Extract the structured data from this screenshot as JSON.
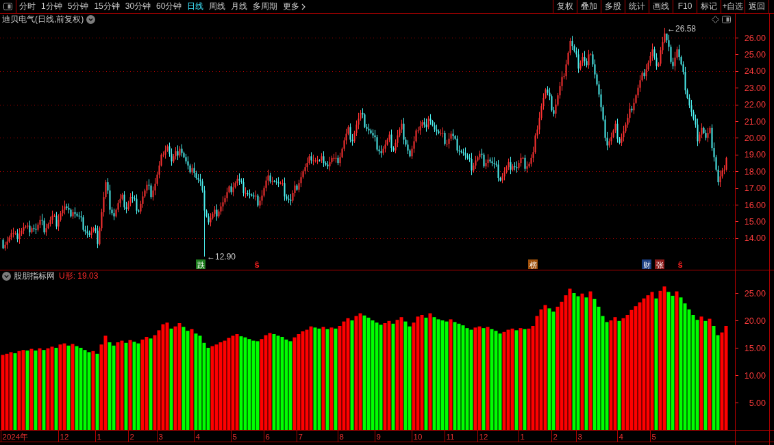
{
  "toolbar": {
    "periods": [
      {
        "label": "分时",
        "selected": false
      },
      {
        "label": "1分钟",
        "selected": false
      },
      {
        "label": "5分钟",
        "selected": false
      },
      {
        "label": "15分钟",
        "selected": false
      },
      {
        "label": "30分钟",
        "selected": false
      },
      {
        "label": "60分钟",
        "selected": false
      },
      {
        "label": "日线",
        "selected": true
      },
      {
        "label": "周线",
        "selected": false
      },
      {
        "label": "月线",
        "selected": false
      },
      {
        "label": "多周期",
        "selected": false
      }
    ],
    "more": "更多",
    "actions": [
      "复权",
      "叠加",
      "多股",
      "统计",
      "画线",
      "F10",
      "标记",
      "+自选",
      "返回"
    ]
  },
  "price_panel": {
    "title": "迪贝电气(日线,前复权)",
    "price_labels": [
      "←12.90",
      "←26.58"
    ],
    "events": [
      {
        "kind": "badge",
        "label": "跌",
        "color": "#1f7f1f"
      },
      {
        "kind": "mark",
        "label": "ŝ",
        "color": "#ff2020"
      },
      {
        "kind": "badge",
        "label": "榜",
        "color": "#a0500a"
      },
      {
        "kind": "badge",
        "label": "财",
        "color": "#1c3f82"
      },
      {
        "kind": "badge",
        "label": "张",
        "color": "#8c1a1a"
      },
      {
        "kind": "mark",
        "label": "ŝ",
        "color": "#ff2020"
      }
    ],
    "price_axis": [
      "26.00",
      "25.00",
      "24.00",
      "23.00",
      "22.00",
      "21.00",
      "20.00",
      "19.00",
      "18.00",
      "17.00",
      "16.00",
      "15.00",
      "14.00"
    ]
  },
  "indicator_panel": {
    "title": "股朋指标网",
    "reading": "U形: 19.03",
    "chart_data": {
      "type": "bar",
      "stacked": true,
      "ylim": [
        0,
        27
      ],
      "yticks": [
        {
          "value": 5,
          "label": "5.00"
        },
        {
          "value": 10,
          "label": "10.00"
        },
        {
          "value": 15,
          "label": "15.00"
        },
        {
          "value": 20,
          "label": "20.00"
        },
        {
          "value": 25,
          "label": "25.00"
        }
      ],
      "series": [
        {
          "color": "#ff0000",
          "values": [
            13.7,
            13.9,
            14.2,
            null,
            14.4,
            14.6,
            null,
            14.8,
            null,
            14.9,
            null,
            14.9,
            15.2,
            null,
            15.6,
            15.8,
            null,
            15.7,
            null,
            null,
            null,
            null,
            14.4,
            null,
            15.6,
            17.2,
            null,
            null,
            16.0,
            16.3,
            null,
            16.4,
            null,
            null,
            16.5,
            17.0,
            null,
            17.3,
            18.2,
            19.3,
            19.6,
            null,
            18.9,
            19.5,
            null,
            null,
            18.4,
            null,
            null,
            null,
            null,
            15.3,
            15.6,
            16.0,
            16.3,
            16.8,
            17.2,
            17.5,
            null,
            null,
            null,
            null,
            null,
            16.6,
            17.3,
            17.7,
            null,
            null,
            null,
            null,
            null,
            16.9,
            17.5,
            18.0,
            18.3,
            18.9,
            null,
            null,
            18.8,
            null,
            18.7,
            null,
            19.0,
            19.8,
            20.4,
            null,
            20.8,
            21.3,
            null,
            null,
            null,
            null,
            null,
            19.5,
            19.9,
            null,
            20.1,
            20.6,
            null,
            null,
            19.6,
            20.7,
            21.0,
            null,
            21.3,
            null,
            null,
            null,
            null,
            20.2,
            null,
            null,
            null,
            null,
            null,
            18.7,
            18.9,
            null,
            18.8,
            null,
            null,
            null,
            17.9,
            18.3,
            18.5,
            null,
            18.6,
            null,
            18.5,
            19.0,
            20.8,
            22.0,
            22.8,
            null,
            null,
            22.5,
            23.4,
            24.6,
            25.8,
            null,
            null,
            24.9,
            null,
            25.3,
            null,
            null,
            null,
            null,
            20.0,
            20.6,
            null,
            20.4,
            21.0,
            21.9,
            22.6,
            23.3,
            24.0,
            24.6,
            25.2,
            null,
            25.4,
            26.2,
            null,
            null,
            25.3,
            null,
            null,
            null,
            null,
            null,
            20.7,
            null,
            20.3,
            null,
            null,
            17.8,
            19.0
          ]
        },
        {
          "color": "#00ff00",
          "values": [
            null,
            null,
            null,
            14.0,
            null,
            null,
            14.5,
            null,
            14.5,
            null,
            14.6,
            null,
            null,
            15.0,
            null,
            null,
            15.4,
            null,
            15.3,
            15.0,
            14.6,
            14.2,
            null,
            13.9,
            null,
            null,
            16.0,
            15.4,
            null,
            null,
            15.9,
            null,
            16.1,
            15.8,
            null,
            null,
            16.7,
            null,
            null,
            null,
            null,
            18.5,
            null,
            null,
            18.8,
            18.1,
            null,
            17.6,
            17.2,
            15.9,
            15.0,
            null,
            null,
            null,
            null,
            null,
            null,
            null,
            17.1,
            16.9,
            16.6,
            16.3,
            16.2,
            null,
            null,
            null,
            17.5,
            17.2,
            17.0,
            16.5,
            16.2,
            null,
            null,
            null,
            null,
            null,
            18.7,
            18.5,
            null,
            18.4,
            null,
            18.5,
            null,
            null,
            null,
            20.0,
            null,
            null,
            20.9,
            20.5,
            20.0,
            19.6,
            19.2,
            null,
            null,
            19.4,
            null,
            null,
            19.8,
            18.9,
            null,
            null,
            null,
            20.5,
            null,
            20.6,
            20.2,
            20.0,
            19.8,
            null,
            19.7,
            19.4,
            19.1,
            18.6,
            18.3,
            null,
            null,
            18.6,
            null,
            18.4,
            18.1,
            17.6,
            null,
            null,
            null,
            18.2,
            null,
            18.4,
            null,
            null,
            null,
            null,
            null,
            22.2,
            21.6,
            null,
            null,
            null,
            null,
            25.0,
            24.4,
            null,
            24.2,
            null,
            23.9,
            22.5,
            20.8,
            19.7,
            null,
            null,
            19.9,
            null,
            null,
            null,
            null,
            null,
            null,
            null,
            null,
            24.0,
            null,
            null,
            25.2,
            24.5,
            null,
            24.2,
            23.1,
            22.0,
            21.0,
            20.1,
            null,
            19.9,
            null,
            19.0,
            17.3,
            null,
            null
          ]
        }
      ]
    },
    "time_axis": [
      "2024年",
      "12",
      "1",
      "2",
      "3",
      "4",
      "5",
      "6",
      "7",
      "8",
      "9",
      "10",
      "11",
      "12",
      "1",
      "2",
      "3",
      "4",
      "5"
    ]
  }
}
